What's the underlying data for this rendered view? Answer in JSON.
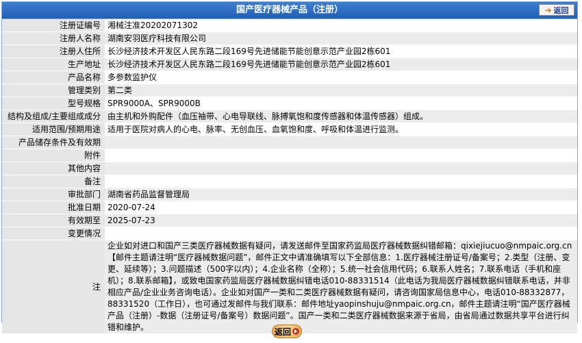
{
  "header": {
    "title": "国产医疗器械产品（注册）",
    "back_label": "返回"
  },
  "rows": [
    {
      "label": "注册证编号",
      "value": "湘械注准20202071302"
    },
    {
      "label": "注册人名称",
      "value": "湖南安羽医疗科技有限公司"
    },
    {
      "label": "注册人住所",
      "value": "长沙经济技术开发区人民东路二段169号先进储能节能创意示范产业园2栋601"
    },
    {
      "label": "生产地址",
      "value": "长沙经济技术开发区人民东路二段169号先进储能节能创意示范产业园2栋601"
    },
    {
      "label": "产品名称",
      "value": "多参数监护仪"
    },
    {
      "label": "管理类别",
      "value": "第二类"
    },
    {
      "label": "型号规格",
      "value": "SPR9000A、SPR9000B"
    },
    {
      "label": "结构及组成/主要组成成分",
      "value": "由主机和外购配件（血压袖带、心电导联线、脉搏氧饱和度传感器和体温传感器）组成。"
    },
    {
      "label": "适用范围/预期用途",
      "value": "适用于医院对病人的心电、脉率、无创血压、血氧饱和度、呼吸和体温进行监测。"
    },
    {
      "label": "产品储存条件及有效期",
      "value": ""
    },
    {
      "label": "附件",
      "value": ""
    },
    {
      "label": "其他内容",
      "value": ""
    },
    {
      "label": "备注",
      "value": ""
    },
    {
      "label": "审批部门",
      "value": "湖南省药品监督管理局"
    },
    {
      "label": "批准日期",
      "value": "2020-07-24"
    },
    {
      "label": "有效期至",
      "value": "2025-07-23"
    },
    {
      "label": "变更情况",
      "value": ""
    }
  ],
  "note": {
    "label": "注",
    "text": "企业如对进口和国产三类医疗器械数据有疑问，请发送邮件至国家药监局医疗器械数据纠错邮箱：qixiejiucuo@nmpaic.org.cn【邮件主题请注明“医疗器械数据问题”，邮件正文中请准确填写以下全部信息：1.医疗器械注册证号/备案号；2.类型（注册、变更、延续等）；3.问题描述（500字以内）；4.企业名称（全称）；5.统一社会信用代码；6.联系人姓名；7.联系电话（手机和座机）；8.联系邮箱】，或致电国家药监局医疗器械数据纠错电话010-88331514（此电话为我局医疗器械数据纠错联系电话，并非相应产品/企业业务咨询电话）。企业如对国产一类和二类医疗器械数据有疑问，请咨询国家局信息中心，电话010-88332877，88331520（工作日），也可通过发邮件与我们联系：邮件地址yaopinshuju@nmpaic.org.cn，邮件主题请注明“国产医疗器械产品（注册）-数据（注册证号/备案号）数据问题”。国产一类和二类医疗器械数据来源于省局，由省局通过数据共享平台进行纠错和维护。"
  },
  "footer": {
    "back_label": "返回"
  }
}
